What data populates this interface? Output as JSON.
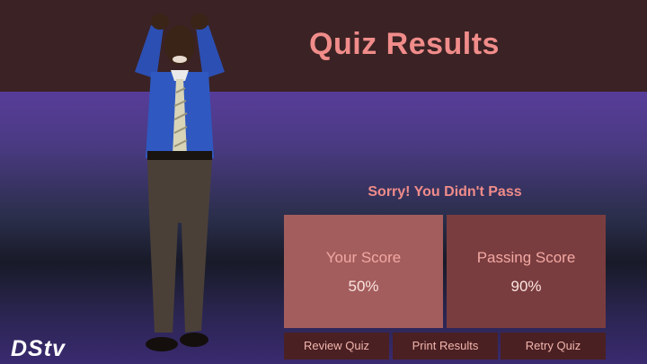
{
  "header": {
    "title": "Quiz Results"
  },
  "result": {
    "message": "Sorry! You Didn't Pass"
  },
  "score": {
    "label": "Your Score",
    "value": "50%"
  },
  "passing": {
    "label": "Passing Score",
    "value": "90%"
  },
  "buttons": {
    "review": "Review Quiz",
    "print": "Print Results",
    "retry": "Retry Quiz"
  },
  "logo": {
    "text": "DStv"
  },
  "colors": {
    "header": "#3b2224",
    "accent": "#f08c8a",
    "score_box": "#a35d5c",
    "passing_box": "#7a3d3f",
    "button": "#4a2022"
  }
}
